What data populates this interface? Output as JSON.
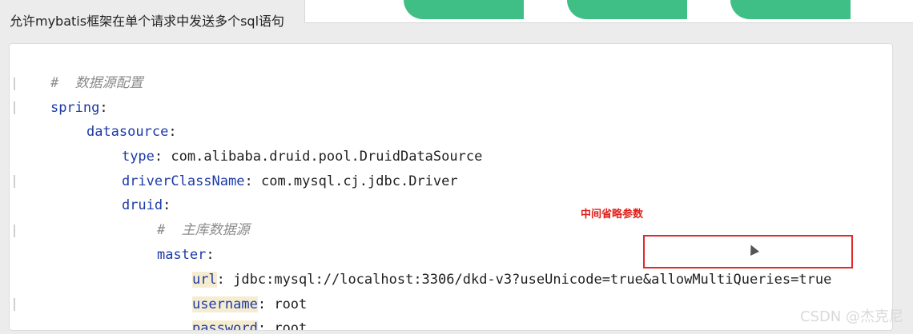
{
  "caption": "允许mybatis框架在单个请求中发送多个sql语句",
  "code": {
    "comment_datasource": "#  数据源配置",
    "spring_key": "spring",
    "datasource_key": "datasource",
    "type_key": "type",
    "type_value": "com.alibaba.druid.pool.DruidDataSource",
    "driver_key": "driverClassName",
    "driver_value": "com.mysql.cj.jdbc.Driver",
    "druid_key": "druid",
    "comment_master": "#  主库数据源",
    "master_key": "master",
    "url_key": "url",
    "url_value_part1": "jdbc:mysql://localhost:3306/dkd-v3?useUnicode=true",
    "url_value_part2": "&allowMultiQueries=true",
    "username_key": "username",
    "username_value": "root",
    "password_key": "password",
    "password_value": "root"
  },
  "annotation": {
    "note": "中间省略参数",
    "box_color": "#e02a2a"
  },
  "colors": {
    "key": "#1c3aa8",
    "comment": "#8c8c8c",
    "note": "#e0201a",
    "thumb": "#3fbf86"
  },
  "watermark": "CSDN @杰克尼"
}
